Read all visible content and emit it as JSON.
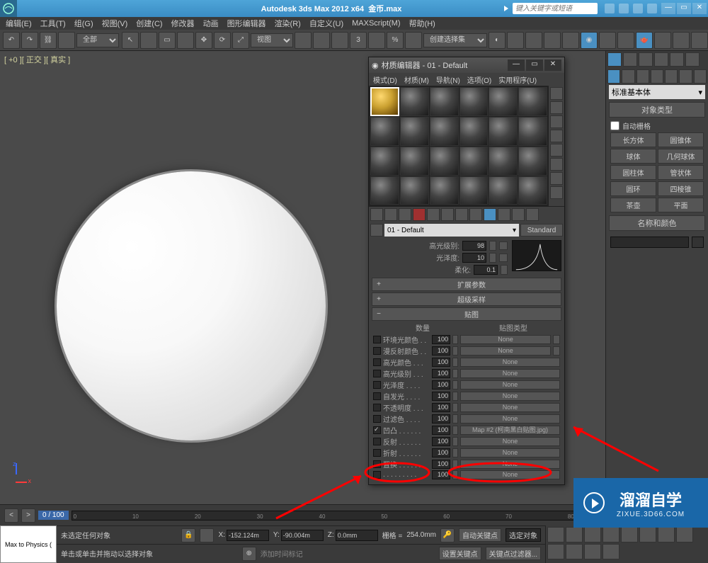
{
  "titlebar": {
    "app": "Autodesk 3ds Max  2012 x64",
    "doc": "金币.max",
    "search_ph": "键入关键字或短语"
  },
  "menubar": [
    "编辑(E)",
    "工具(T)",
    "组(G)",
    "视图(V)",
    "创建(C)",
    "修改器",
    "动画",
    "图形编辑器",
    "渲染(R)",
    "自定义(U)",
    "MAXScript(M)",
    "帮助(H)"
  ],
  "toolbar": {
    "all": "全部",
    "view": "视图",
    "selset": "创建选择集"
  },
  "viewport": {
    "label": "[ +0 ][ 正交 ][ 真实 ]"
  },
  "right_panel": {
    "dropdown": "标准基本体",
    "rollout_objtype": "对象类型",
    "autogrid": "自动栅格",
    "prims": [
      [
        "长方体",
        "圆锥体"
      ],
      [
        "球体",
        "几何球体"
      ],
      [
        "圆柱体",
        "管状体"
      ],
      [
        "圆环",
        "四棱锥"
      ],
      [
        "茶壶",
        "平面"
      ]
    ],
    "rollout_name": "名称和颜色"
  },
  "mat_editor": {
    "title": "材质编辑器 - 01 - Default",
    "menus": [
      "模式(D)",
      "材质(M)",
      "导航(N)",
      "选项(O)",
      "实用程序(U)"
    ],
    "name": "01 - Default",
    "type": "Standard",
    "params": {
      "spec_level_lbl": "高光级别:",
      "spec_level": "98",
      "gloss_lbl": "光泽度:",
      "gloss": "10",
      "soften_lbl": "柔化:",
      "soften": "0.1"
    },
    "sections": {
      "ext": "扩展参数",
      "super": "超级采样",
      "maps": "贴图"
    },
    "maps": {
      "hdr_qty": "数量",
      "hdr_type": "贴图类型",
      "rows": [
        {
          "checked": false,
          "label": "环境光颜色 . .",
          "val": "100",
          "btn": "None",
          "side": true
        },
        {
          "checked": false,
          "label": "漫反射颜色 . .",
          "val": "100",
          "btn": "None",
          "side": true
        },
        {
          "checked": false,
          "label": "高光颜色 . . .",
          "val": "100",
          "btn": "None"
        },
        {
          "checked": false,
          "label": "高光级别 . . .",
          "val": "100",
          "btn": "None"
        },
        {
          "checked": false,
          "label": "光泽度 . . . .",
          "val": "100",
          "btn": "None"
        },
        {
          "checked": false,
          "label": "自发光 . . . .",
          "val": "100",
          "btn": "None"
        },
        {
          "checked": false,
          "label": "不透明度 . . .",
          "val": "100",
          "btn": "None"
        },
        {
          "checked": false,
          "label": "过滤色 . . . .",
          "val": "100",
          "btn": "None"
        },
        {
          "checked": true,
          "label": "凹凸 . . . . . .",
          "val": "100",
          "btn": "Map #2 (柯南黑白贴图.jpg)"
        },
        {
          "checked": false,
          "label": "反射 . . . . . .",
          "val": "100",
          "btn": "None"
        },
        {
          "checked": false,
          "label": "折射 . . . . . .",
          "val": "100",
          "btn": "None"
        },
        {
          "checked": false,
          "label": "置换 . . . . . .",
          "val": "100",
          "btn": "None"
        },
        {
          "checked": false,
          "label": ". . . . . . . . .",
          "val": "100",
          "btn": "None"
        }
      ]
    }
  },
  "timeline": {
    "range": "0 / 100"
  },
  "status": {
    "maxscript": "Max to Physics (",
    "nosel": "未选定任何对象",
    "hint": "单击或单击并拖动以选择对象",
    "x": "X:",
    "xv": "-152.124m",
    "y": "Y:",
    "yv": "-90.004m",
    "z": "Z:",
    "zv": "0.0mm",
    "grid_lbl": "栅格 =",
    "grid": "254.0mm",
    "autokey": "自动关键点",
    "selset": "选定对象",
    "setkey": "设置关键点",
    "keyfilter": "关键点过滤器...",
    "add_time": "添加时间标记"
  },
  "watermark": {
    "big": "溜溜自学",
    "small": "ZIXUE.3D66.COM"
  }
}
